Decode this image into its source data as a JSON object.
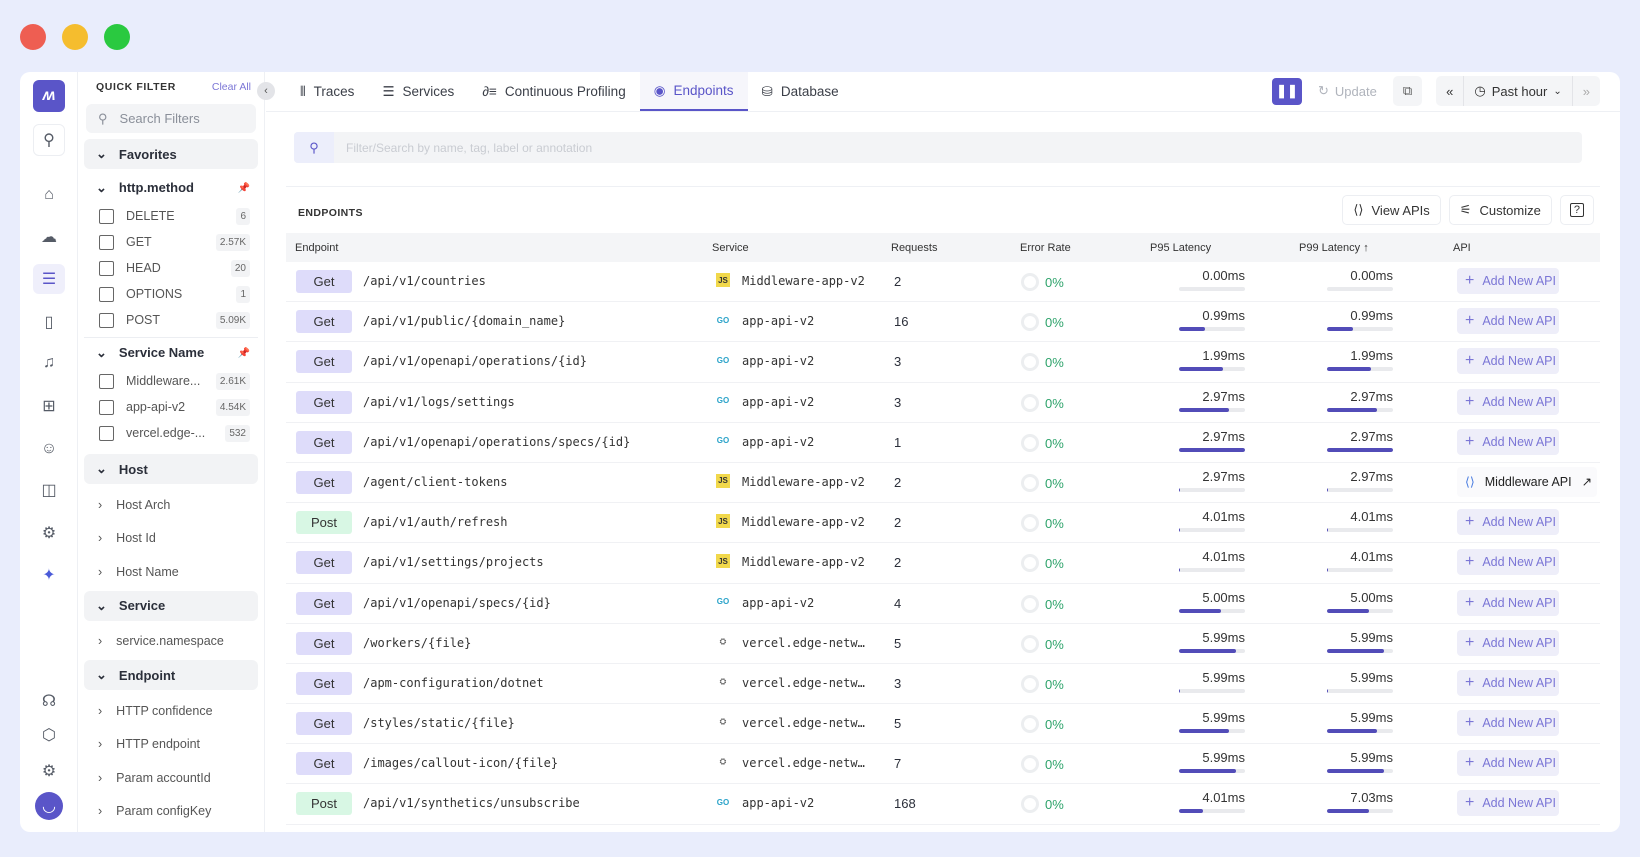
{
  "window_controls": {
    "close": "#ee5e52",
    "minimize": "#f5bd2e",
    "maximize": "#2ac940"
  },
  "accent": "#5a55c8",
  "rail": {
    "icons": [
      "logo-icon",
      "search-icon",
      "home-icon",
      "infrastructure-icon",
      "apm-icon",
      "logs-icon",
      "alerts-icon",
      "dashboard-add-icon",
      "bot-icon",
      "rum-icon",
      "chip-icon",
      "ai-sparkle-icon",
      "support-icon",
      "package-icon",
      "settings-icon",
      "avatar-icon"
    ]
  },
  "quick_filter": {
    "title": "QUICK FILTER",
    "clear_all": "Clear All",
    "search_placeholder": "Search Filters",
    "favorites": "Favorites",
    "http_method": {
      "label": "http.method",
      "items": [
        {
          "label": "DELETE",
          "count": "6"
        },
        {
          "label": "GET",
          "count": "2.57K"
        },
        {
          "label": "HEAD",
          "count": "20"
        },
        {
          "label": "OPTIONS",
          "count": "1"
        },
        {
          "label": "POST",
          "count": "5.09K"
        }
      ]
    },
    "service_name": {
      "label": "Service Name",
      "items": [
        {
          "label": "Middleware...",
          "count": "2.61K"
        },
        {
          "label": "app-api-v2",
          "count": "4.54K"
        },
        {
          "label": "vercel.edge-...",
          "count": "532"
        }
      ]
    },
    "host": {
      "label": "Host",
      "items": [
        "Host Arch",
        "Host Id",
        "Host Name"
      ]
    },
    "service": {
      "label": "Service",
      "items": [
        "service.namespace"
      ]
    },
    "endpoint": {
      "label": "Endpoint",
      "items": [
        "HTTP confidence",
        "HTTP endpoint",
        "Param accountId",
        "Param configKey"
      ]
    }
  },
  "tabs": [
    {
      "label": "Traces",
      "icon": "traces-icon"
    },
    {
      "label": "Services",
      "icon": "list-icon"
    },
    {
      "label": "Continuous Profiling",
      "icon": "profiling-icon"
    },
    {
      "label": "Endpoints",
      "icon": "endpoints-icon",
      "active": true
    },
    {
      "label": "Database",
      "icon": "database-icon"
    }
  ],
  "toolbar": {
    "update": "Update",
    "time_range": "Past hour"
  },
  "search": {
    "placeholder": "Filter/Search by name, tag, label or annotation"
  },
  "endpoints": {
    "title": "ENDPOINTS",
    "view_apis": "View APIs",
    "customize": "Customize",
    "help": "?",
    "columns": [
      "Endpoint",
      "Service",
      "Requests",
      "Error Rate",
      "P95 Latency",
      "P99 Latency ↑",
      "API"
    ],
    "add_api_label": "Add New API",
    "rows": [
      {
        "method": "Get",
        "path": "/api/v1/countries",
        "service": "Middleware-app-v2",
        "lang": "js",
        "requests": "2",
        "error": "0%",
        "p95": "0.00ms",
        "p95_fill": 0,
        "p99": "0.00ms",
        "p99_fill": 0
      },
      {
        "method": "Get",
        "path": "/api/v1/public/{domain_name}",
        "service": "app-api-v2",
        "lang": "go",
        "requests": "16",
        "error": "0%",
        "p95": "0.99ms",
        "p95_fill": 0.4,
        "p99": "0.99ms",
        "p99_fill": 0.4
      },
      {
        "method": "Get",
        "path": "/api/v1/openapi/operations/{id}",
        "service": "app-api-v2",
        "lang": "go",
        "requests": "3",
        "error": "0%",
        "p95": "1.99ms",
        "p95_fill": 0.67,
        "p99": "1.99ms",
        "p99_fill": 0.67
      },
      {
        "method": "Get",
        "path": "/api/v1/logs/settings",
        "service": "app-api-v2",
        "lang": "go",
        "requests": "3",
        "error": "0%",
        "p95": "2.97ms",
        "p95_fill": 0.75,
        "p99": "2.97ms",
        "p99_fill": 0.75
      },
      {
        "method": "Get",
        "path": "/api/v1/openapi/operations/specs/{id}",
        "service": "app-api-v2",
        "lang": "go",
        "requests": "1",
        "error": "0%",
        "p95": "2.97ms",
        "p95_fill": 1,
        "p99": "2.97ms",
        "p99_fill": 1
      },
      {
        "method": "Get",
        "path": "/agent/client-tokens",
        "service": "Middleware-app-v2",
        "lang": "js",
        "requests": "2",
        "error": "0%",
        "p95": "2.97ms",
        "p95_fill": 0.02,
        "p99": "2.97ms",
        "p99_fill": 0.02,
        "api": "Middleware API"
      },
      {
        "method": "Post",
        "path": "/api/v1/auth/refresh",
        "service": "Middleware-app-v2",
        "lang": "js",
        "requests": "2",
        "error": "0%",
        "p95": "4.01ms",
        "p95_fill": 0.02,
        "p99": "4.01ms",
        "p99_fill": 0.02
      },
      {
        "method": "Get",
        "path": "/api/v1/settings/projects",
        "service": "Middleware-app-v2",
        "lang": "js",
        "requests": "2",
        "error": "0%",
        "p95": "4.01ms",
        "p95_fill": 0.02,
        "p99": "4.01ms",
        "p99_fill": 0.02
      },
      {
        "method": "Get",
        "path": "/api/v1/openapi/specs/{id}",
        "service": "app-api-v2",
        "lang": "go",
        "requests": "4",
        "error": "0%",
        "p95": "5.00ms",
        "p95_fill": 0.63,
        "p99": "5.00ms",
        "p99_fill": 0.63
      },
      {
        "method": "Get",
        "path": "/workers/{file}",
        "service": "vercel.edge-netwo...",
        "lang": "edge",
        "requests": "5",
        "error": "0%",
        "p95": "5.99ms",
        "p95_fill": 0.87,
        "p99": "5.99ms",
        "p99_fill": 0.87
      },
      {
        "method": "Get",
        "path": "/apm-configuration/dotnet",
        "service": "vercel.edge-netwo...",
        "lang": "edge",
        "requests": "3",
        "error": "0%",
        "p95": "5.99ms",
        "p95_fill": 0.02,
        "p99": "5.99ms",
        "p99_fill": 0.02
      },
      {
        "method": "Get",
        "path": "/styles/static/{file}",
        "service": "vercel.edge-netwo...",
        "lang": "edge",
        "requests": "5",
        "error": "0%",
        "p95": "5.99ms",
        "p95_fill": 0.75,
        "p99": "5.99ms",
        "p99_fill": 0.75
      },
      {
        "method": "Get",
        "path": "/images/callout-icon/{file}",
        "service": "vercel.edge-netwo...",
        "lang": "edge",
        "requests": "7",
        "error": "0%",
        "p95": "5.99ms",
        "p95_fill": 0.87,
        "p99": "5.99ms",
        "p99_fill": 0.87
      },
      {
        "method": "Post",
        "path": "/api/v1/synthetics/unsubscribe",
        "service": "app-api-v2",
        "lang": "go",
        "requests": "168",
        "error": "0%",
        "p95": "4.01ms",
        "p95_fill": 0.36,
        "p99": "7.03ms",
        "p99_fill": 0.63
      }
    ]
  }
}
